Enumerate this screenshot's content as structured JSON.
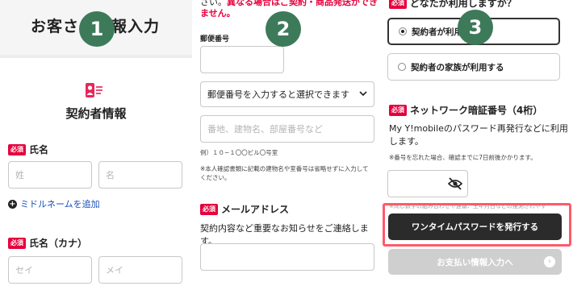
{
  "panel1": {
    "title": "お客さま情報入力",
    "step": "1",
    "section_title": "契約者情報",
    "required_badge": "必須",
    "name_label": "氏名",
    "last_name_placeholder": "姓",
    "first_name_placeholder": "名",
    "middle_name_link": "ミドルネームを追加",
    "kana_label": "氏名（カナ）",
    "last_kana_placeholder": "セイ",
    "first_kana_placeholder": "メイ"
  },
  "panel2": {
    "step": "2",
    "top_text_plain": "さい。",
    "top_text_red": "異なる場合はご契約・商品発送ができません。",
    "postal_label": "郵便番号",
    "address_select": "郵便番号を入力すると選択できます",
    "address_placeholder": "番地、建物名、部屋番号など",
    "example_text": "例）１０−１〇〇ビル〇号室",
    "note_text": "※本人確認書類に記載の建物名や室番号は省略せずに入力してください。",
    "required_badge": "必須",
    "email_label": "メールアドレス",
    "email_description": "契約内容など重要なお知らせをご連絡します。"
  },
  "panel3": {
    "step": "3",
    "required_badge": "必須",
    "question": "どなたが利用しますか？",
    "option_contractor": "契約者が利用する",
    "option_family": "契約者の家族が利用する",
    "pin_label": "ネットワーク暗証番号（4桁）",
    "pin_description": "My Y!mobileのパスワード再発行などに利用します。",
    "pin_note": "※番号を忘れた場合、確認までに7日前後かかります。",
    "warning_text": "※同じ数字の組み合わせや連番、生年月日などの推測されやす",
    "otp_button": "ワンタイムパスワードを発行する",
    "next_button": "お支払い情報入力へ"
  },
  "colors": {
    "required_red": "#e6003c",
    "step_green": "#3d7a5a",
    "highlight": "#ff5a6a",
    "link_blue": "#1a4fb8"
  }
}
